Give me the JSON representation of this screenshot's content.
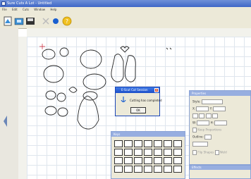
{
  "window": {
    "title": "Sure Cuts A Lot - Untitled"
  },
  "menu": [
    "File",
    "Edit",
    "Cuts",
    "Window",
    "Help"
  ],
  "toolbar": {
    "icons": [
      "new-icon",
      "open-icon",
      "save-icon",
      "cut-icon",
      "blob-icon",
      "help-icon"
    ]
  },
  "dialog": {
    "title": "E-Scut Cut Session",
    "message": "Cutting has completed",
    "ok_label": "OK"
  },
  "properties": {
    "title": "Properties",
    "style_label": "Style:",
    "x_label": "X:",
    "y_label": "Y:",
    "w_label": "W:",
    "h_label": "H:",
    "keep_label": "Keep Proportions",
    "outline_label": "Outline:",
    "flip_label": "Flip Shapes",
    "weld_label": "Weld"
  },
  "keypad": {
    "title": "Keys"
  },
  "bottom_panel": {
    "title": "Effects"
  },
  "colors": {
    "title_blue": "#3f67c7",
    "dialog_blue": "#1d4fc9",
    "panel_blue": "#97aee0",
    "grid": "#dfe6ee",
    "chrome": "#ece9d8"
  }
}
